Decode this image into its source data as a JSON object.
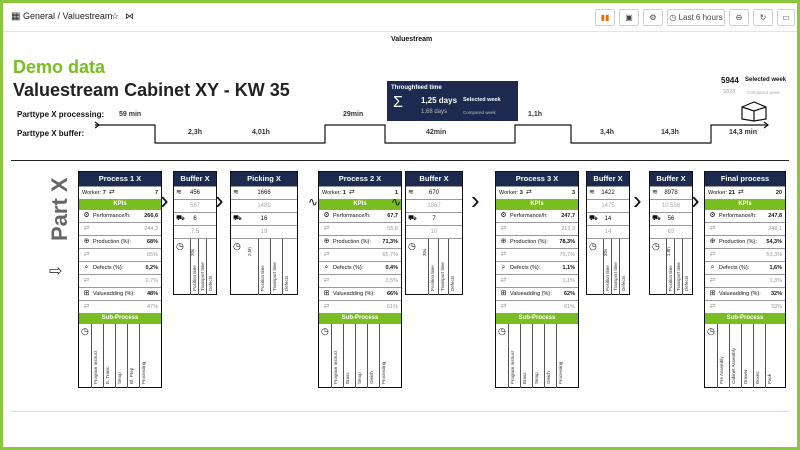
{
  "topbar": {
    "breadcrumb": "General / Valuestream",
    "time_range": "Last 6 hours"
  },
  "page": {
    "panel_title": "Valuestream",
    "demo_label": "Demo data",
    "title": "Valuestream Cabinet XY - KW 35",
    "part_label": "Part X"
  },
  "throughput": {
    "title": "Throughfeed time",
    "value": "1,25 days",
    "value_caption": "Selected week",
    "compared": "1,68 days",
    "compared_caption": "Compared week",
    "sigma": "Σ"
  },
  "count": {
    "value": "5944",
    "value_caption": "Selected week",
    "compared": "5823",
    "compared_caption": "Compared week"
  },
  "timeline": {
    "processing_label": "Parttype X processing:",
    "buffer_label": "Parttype X buffer:",
    "processing_times": [
      "59 min",
      "29min",
      "1,1h"
    ],
    "buffer_times": [
      "2,3h",
      "4,01h",
      "42min",
      "3,4h",
      "14,3h",
      "14,3 min"
    ]
  },
  "processes": [
    {
      "name": "Process 1 X",
      "worker_label": "Worker:",
      "workers": "7",
      "cap": "7",
      "kpis": "KPIs",
      "perf_label": "Performance/h:",
      "perf": "266,6",
      "perf_cmp": "244,3",
      "prod_label": "Production (%):",
      "prod": "68%",
      "prod_cmp": "65%",
      "def_label": "Defects (%):",
      "def": "0,2%",
      "def_cmp": "0,7%",
      "va_label": "Valueadding (%):",
      "va": "48%",
      "va_cmp": "47%",
      "sub": "Sub-Process",
      "subs": [
        "Program Instruct",
        "E. Trans.",
        "Setup",
        "Bf. Prep",
        "Processing"
      ]
    },
    {
      "name": "Process 2 X",
      "worker_label": "Worker:",
      "workers": "1",
      "cap": "1",
      "kpis": "KPIs",
      "perf_label": "Performance/h:",
      "perf": "67,7",
      "perf_cmp": "55,8",
      "prod_label": "Production (%):",
      "prod": "71,3%",
      "prod_cmp": "65,7%",
      "def_label": "Defects (%):",
      "def": "0,4%",
      "def_cmp": "0,5%",
      "va_label": "Valueadding (%):",
      "va": "66%",
      "va_cmp": "61%",
      "sub": "Sub-Process",
      "subs": [
        "Program Instruct",
        "Brass",
        "Setup",
        "Gleich",
        "Processing"
      ]
    },
    {
      "name": "Process 3 X",
      "worker_label": "Worker:",
      "workers": "3",
      "cap": "3",
      "kpis": "KPIs",
      "perf_label": "Performance/h:",
      "perf": "247,7",
      "perf_cmp": "213,9",
      "prod_label": "Production (%):",
      "prod": "78,3%",
      "prod_cmp": "76,7%",
      "def_label": "Defects (%):",
      "def": "1,1%",
      "def_cmp": "1,1%",
      "va_label": "Valueadding (%):",
      "va": "62%",
      "va_cmp": "61%",
      "sub": "Sub-Process",
      "subs": [
        "Program Instruct",
        "Brass",
        "Setup",
        "Gleich",
        "Processing"
      ]
    },
    {
      "name": "Final process",
      "worker_label": "Worker:",
      "workers": "21",
      "cap": "20",
      "kpis": "KPIs",
      "perf_label": "Performance/h:",
      "perf": "247,8",
      "perf_cmp": "248,1",
      "prod_label": "Production (%):",
      "prod": "54,3%",
      "prod_cmp": "53,3%",
      "def_label": "Defects (%):",
      "def": "1,6%",
      "def_cmp": "1,3%",
      "va_label": "Valueadding (%):",
      "va": "32%",
      "va_cmp": "33%",
      "sub": "Sub-Process",
      "subs": [
        "Pre Assembly",
        "Cabinet Assembly",
        "Drawer",
        "Boxes",
        "Pack"
      ]
    }
  ],
  "buffers": [
    {
      "name": "Buffer X",
      "stock": "456",
      "stock_cmp": "567",
      "lines": "6",
      "lines_cmp": "7,5",
      "cap": "20s",
      "labels": [
        "Position time",
        "Transport time",
        "Defects"
      ]
    },
    {
      "name": "Picking X",
      "stock": "1666",
      "stock_cmp": "1489",
      "lines": "16",
      "lines_cmp": "19",
      "cap": "2,5h",
      "labels": [
        "Position time",
        "Transport time",
        "Defects"
      ]
    },
    {
      "name": "Buffer X",
      "stock": "670",
      "stock_cmp": "1067",
      "lines": "7",
      "lines_cmp": "10",
      "cap": "30s",
      "labels": [
        "Position time",
        "Transport time",
        "Defects"
      ]
    },
    {
      "name": "Buffer X",
      "stock": "1422",
      "stock_cmp": "1475",
      "lines": "14",
      "lines_cmp": "14",
      "cap": "20s",
      "labels": [
        "Position time",
        "Transport time",
        "Defects"
      ]
    },
    {
      "name": "Buffer X",
      "stock": "8978",
      "stock_cmp": "10.556",
      "lines": "56",
      "lines_cmp": "65",
      "cap": "1,8h",
      "labels": [
        "Position time",
        "Transport time",
        "Defects"
      ]
    }
  ]
}
